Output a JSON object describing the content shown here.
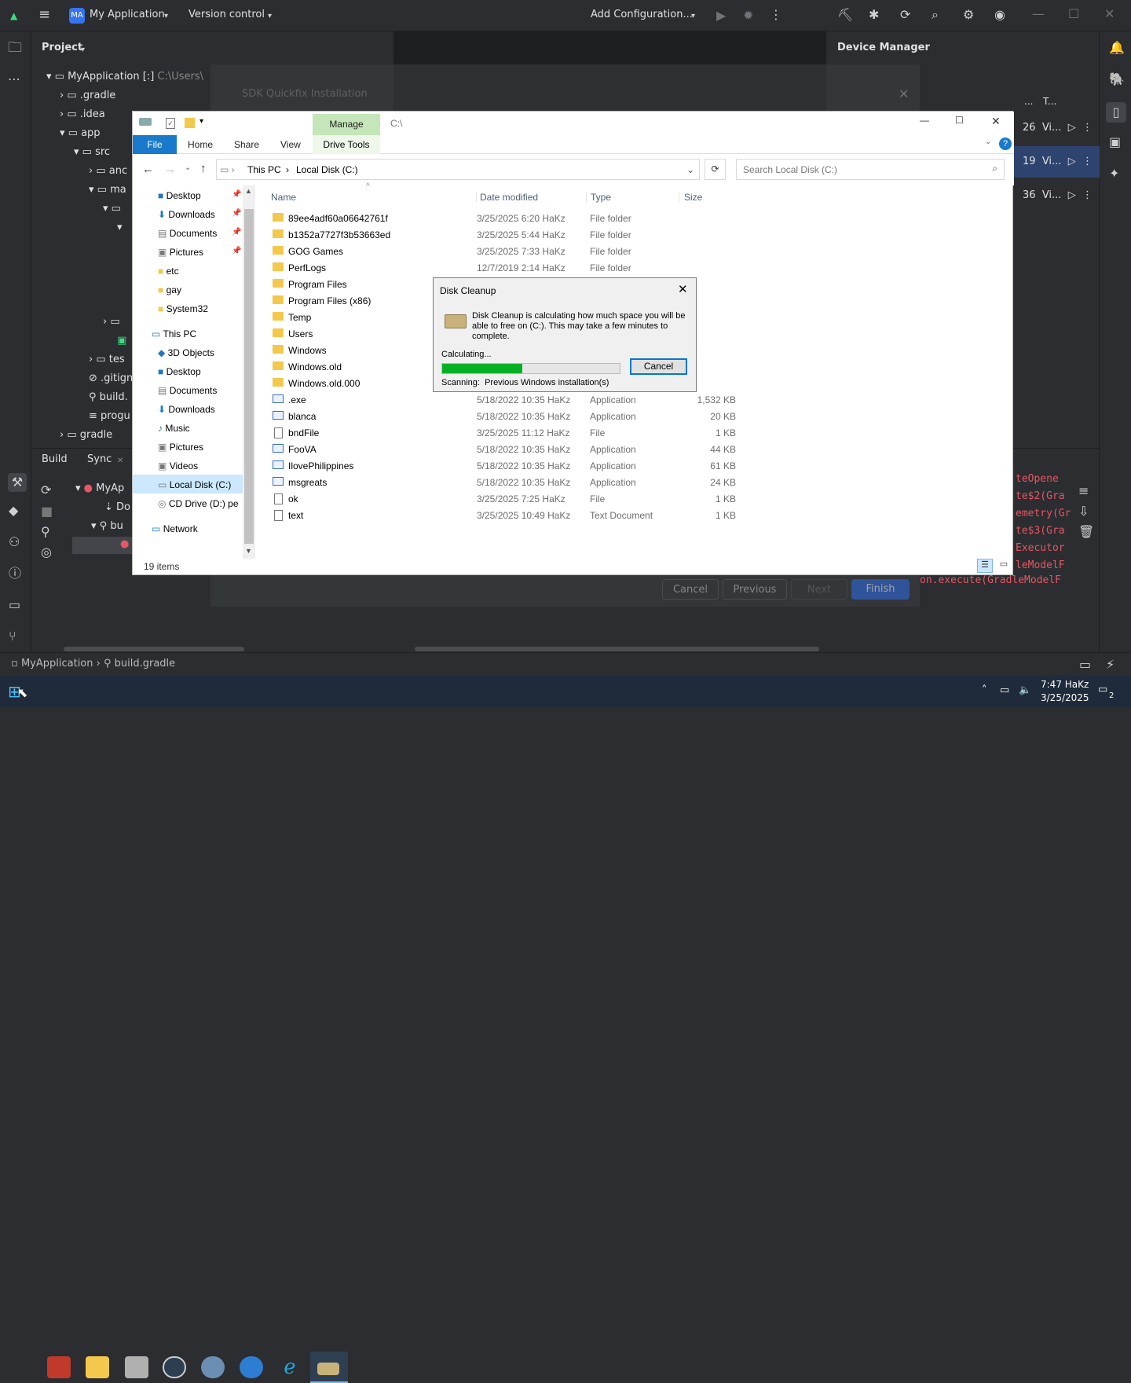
{
  "ide": {
    "project_badge": "MA",
    "project_name": "My Application",
    "vcs": "Version control",
    "run_config": "Add Configuration...",
    "project_panel_title": "Project",
    "device_manager_title": "Device Manager",
    "device_columns": [
      "...",
      "T..."
    ],
    "devices": [
      {
        "api": "26",
        "name": "Vi..."
      },
      {
        "api": "19",
        "name": "Vi..."
      },
      {
        "api": "36",
        "name": "Vi..."
      }
    ],
    "tree": [
      {
        "label": "MyApplication [:]",
        "extra": "C:\\Users\\"
      },
      {
        "label": ".gradle"
      },
      {
        "label": ".idea"
      },
      {
        "label": "app"
      },
      {
        "label": "src"
      },
      {
        "label": "anc"
      },
      {
        "label": "ma"
      },
      {
        "label": "tes"
      },
      {
        "label": ".gitign"
      },
      {
        "label": "build."
      },
      {
        "label": "progu"
      },
      {
        "label": "gradle"
      }
    ],
    "build_tab": "Build",
    "sync_tab": "Sync",
    "build_items": [
      "MyAp",
      "Do",
      "bu"
    ],
    "console_lines": [
      "teOpene",
      "te$2(Gra",
      "emetry(Gr",
      "te$3(Gra",
      "Executor",
      "leModelF",
      "on.execute(GradleModelF"
    ],
    "breadcrumb": [
      "MyApplication",
      "build.gradle"
    ],
    "sdk_dialog_title": "SDK Quickfix Installation",
    "sdk_dialog_buttons": [
      "Cancel",
      "Previous",
      "Next",
      "Finish"
    ]
  },
  "explorer": {
    "title_path": "C:\\",
    "manage_label": "Manage",
    "tabs": [
      "File",
      "Home",
      "Share",
      "View",
      "Drive Tools"
    ],
    "breadcrumb": [
      "This PC",
      "Local Disk (C:)"
    ],
    "search_placeholder": "Search Local Disk (C:)",
    "columns": [
      "Name",
      "Date modified",
      "Type",
      "Size"
    ],
    "quick_access": [
      "Desktop",
      "Downloads",
      "Documents",
      "Pictures",
      "etc",
      "gay",
      "System32"
    ],
    "this_pc": "This PC",
    "pc_items": [
      "3D Objects",
      "Desktop",
      "Documents",
      "Downloads",
      "Music",
      "Pictures",
      "Videos",
      "Local Disk (C:)",
      "CD Drive (D:) pe"
    ],
    "network": "Network",
    "files": [
      {
        "name": "89ee4adf60a06642761f",
        "date": "3/25/2025 6:20 HaKz",
        "type": "File folder",
        "size": "",
        "icon": "folder"
      },
      {
        "name": "b1352a7727f3b53663ed",
        "date": "3/25/2025 5:44 HaKz",
        "type": "File folder",
        "size": "",
        "icon": "folder"
      },
      {
        "name": "GOG Games",
        "date": "3/25/2025 7:33 HaKz",
        "type": "File folder",
        "size": "",
        "icon": "folder"
      },
      {
        "name": "PerfLogs",
        "date": "12/7/2019 2:14 HaKz",
        "type": "File folder",
        "size": "",
        "icon": "folder"
      },
      {
        "name": "Program Files",
        "date": "",
        "type": "",
        "size": "",
        "icon": "folder"
      },
      {
        "name": "Program Files (x86)",
        "date": "",
        "type": "",
        "size": "",
        "icon": "folder"
      },
      {
        "name": "Temp",
        "date": "",
        "type": "",
        "size": "",
        "icon": "folder"
      },
      {
        "name": "Users",
        "date": "",
        "type": "",
        "size": "",
        "icon": "folder"
      },
      {
        "name": "Windows",
        "date": "",
        "type": "",
        "size": "",
        "icon": "folder"
      },
      {
        "name": "Windows.old",
        "date": "",
        "type": "",
        "size": "",
        "icon": "folder"
      },
      {
        "name": "Windows.old.000",
        "date": "",
        "type": "",
        "size": "",
        "icon": "folder"
      },
      {
        "name": ".exe",
        "date": "5/18/2022 10:35 HaKz",
        "type": "Application",
        "size": "1,532 KB",
        "icon": "app"
      },
      {
        "name": "blanca",
        "date": "5/18/2022 10:35 HaKz",
        "type": "Application",
        "size": "20 KB",
        "icon": "app"
      },
      {
        "name": "bndFile",
        "date": "3/25/2025 11:12 HaKz",
        "type": "File",
        "size": "1 KB",
        "icon": "file"
      },
      {
        "name": "FooVA",
        "date": "5/18/2022 10:35 HaKz",
        "type": "Application",
        "size": "44 KB",
        "icon": "app"
      },
      {
        "name": "IlovePhilippines",
        "date": "5/18/2022 10:35 HaKz",
        "type": "Application",
        "size": "61 KB",
        "icon": "app"
      },
      {
        "name": "msgreats",
        "date": "5/18/2022 10:35 HaKz",
        "type": "Application",
        "size": "24 KB",
        "icon": "app"
      },
      {
        "name": "ok",
        "date": "3/25/2025 7:25 HaKz",
        "type": "File",
        "size": "1 KB",
        "icon": "file"
      },
      {
        "name": "text",
        "date": "3/25/2025 10:49 HaKz",
        "type": "Text Document",
        "size": "1 KB",
        "icon": "file"
      }
    ],
    "item_count": "19 items"
  },
  "disk_cleanup": {
    "title": "Disk Cleanup",
    "message": "Disk Cleanup is calculating how much space you will be able to free on  (C:). This may take a few minutes to complete.",
    "calculating": "Calculating...",
    "progress": 0.45,
    "cancel": "Cancel",
    "scanning_label": "Scanning:",
    "scanning_value": "Previous Windows installation(s)"
  },
  "taskbar": {
    "time": "7:47 HaKz",
    "date": "3/25/2025",
    "notifications": "2"
  },
  "colors": {
    "ide_bg": "#2b2d30",
    "accent": "#3574f0",
    "progress": "#06b025",
    "manage_tab": "#c5e6b9",
    "file_tab": "#1979ca"
  }
}
